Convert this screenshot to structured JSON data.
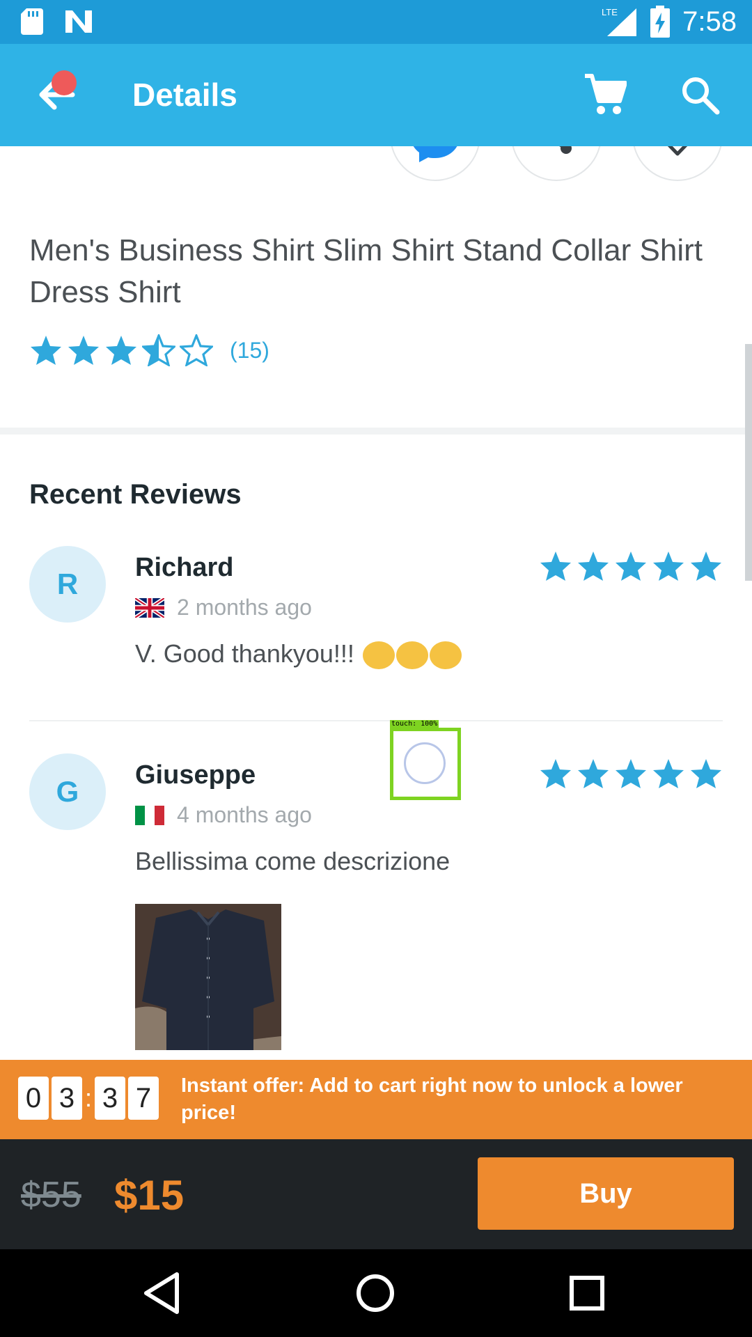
{
  "status_bar": {
    "time": "7:58",
    "network_label": "LTE"
  },
  "app_bar": {
    "title": "Details"
  },
  "product": {
    "title": "Men's Business Shirt Slim Shirt Stand Collar Shirt Dress Shirt",
    "rating": 3.5,
    "rating_max": 5,
    "review_count": "(15)"
  },
  "reviews": {
    "section_title": "Recent Reviews",
    "items": [
      {
        "initial": "R",
        "name": "Richard",
        "country_flag": "uk-flag",
        "date": "2 months ago",
        "text": "V. Good thankyou!!!",
        "stars": 5,
        "emoji_count": 3
      },
      {
        "initial": "G",
        "name": "Giuseppe",
        "country_flag": "italy-flag",
        "date": "4 months ago",
        "text": "Bellissima come descrizione",
        "stars": 5,
        "has_photo": true
      }
    ]
  },
  "touch_overlay": {
    "label": "touch: 100%"
  },
  "offer": {
    "timer": [
      "0",
      "3",
      "3",
      "7"
    ],
    "text": "Instant offer: Add to cart right now to unlock a lower price!"
  },
  "buy_bar": {
    "old_price": "$55",
    "new_price": "$15",
    "buy_label": "Buy"
  },
  "colors": {
    "status_bar": "#1e9bd7",
    "app_bar": "#2fb3e6",
    "accent_blue": "#2fa8dc",
    "offer_orange": "#ee8a2e",
    "buy_bar_bg": "#1f2326"
  }
}
